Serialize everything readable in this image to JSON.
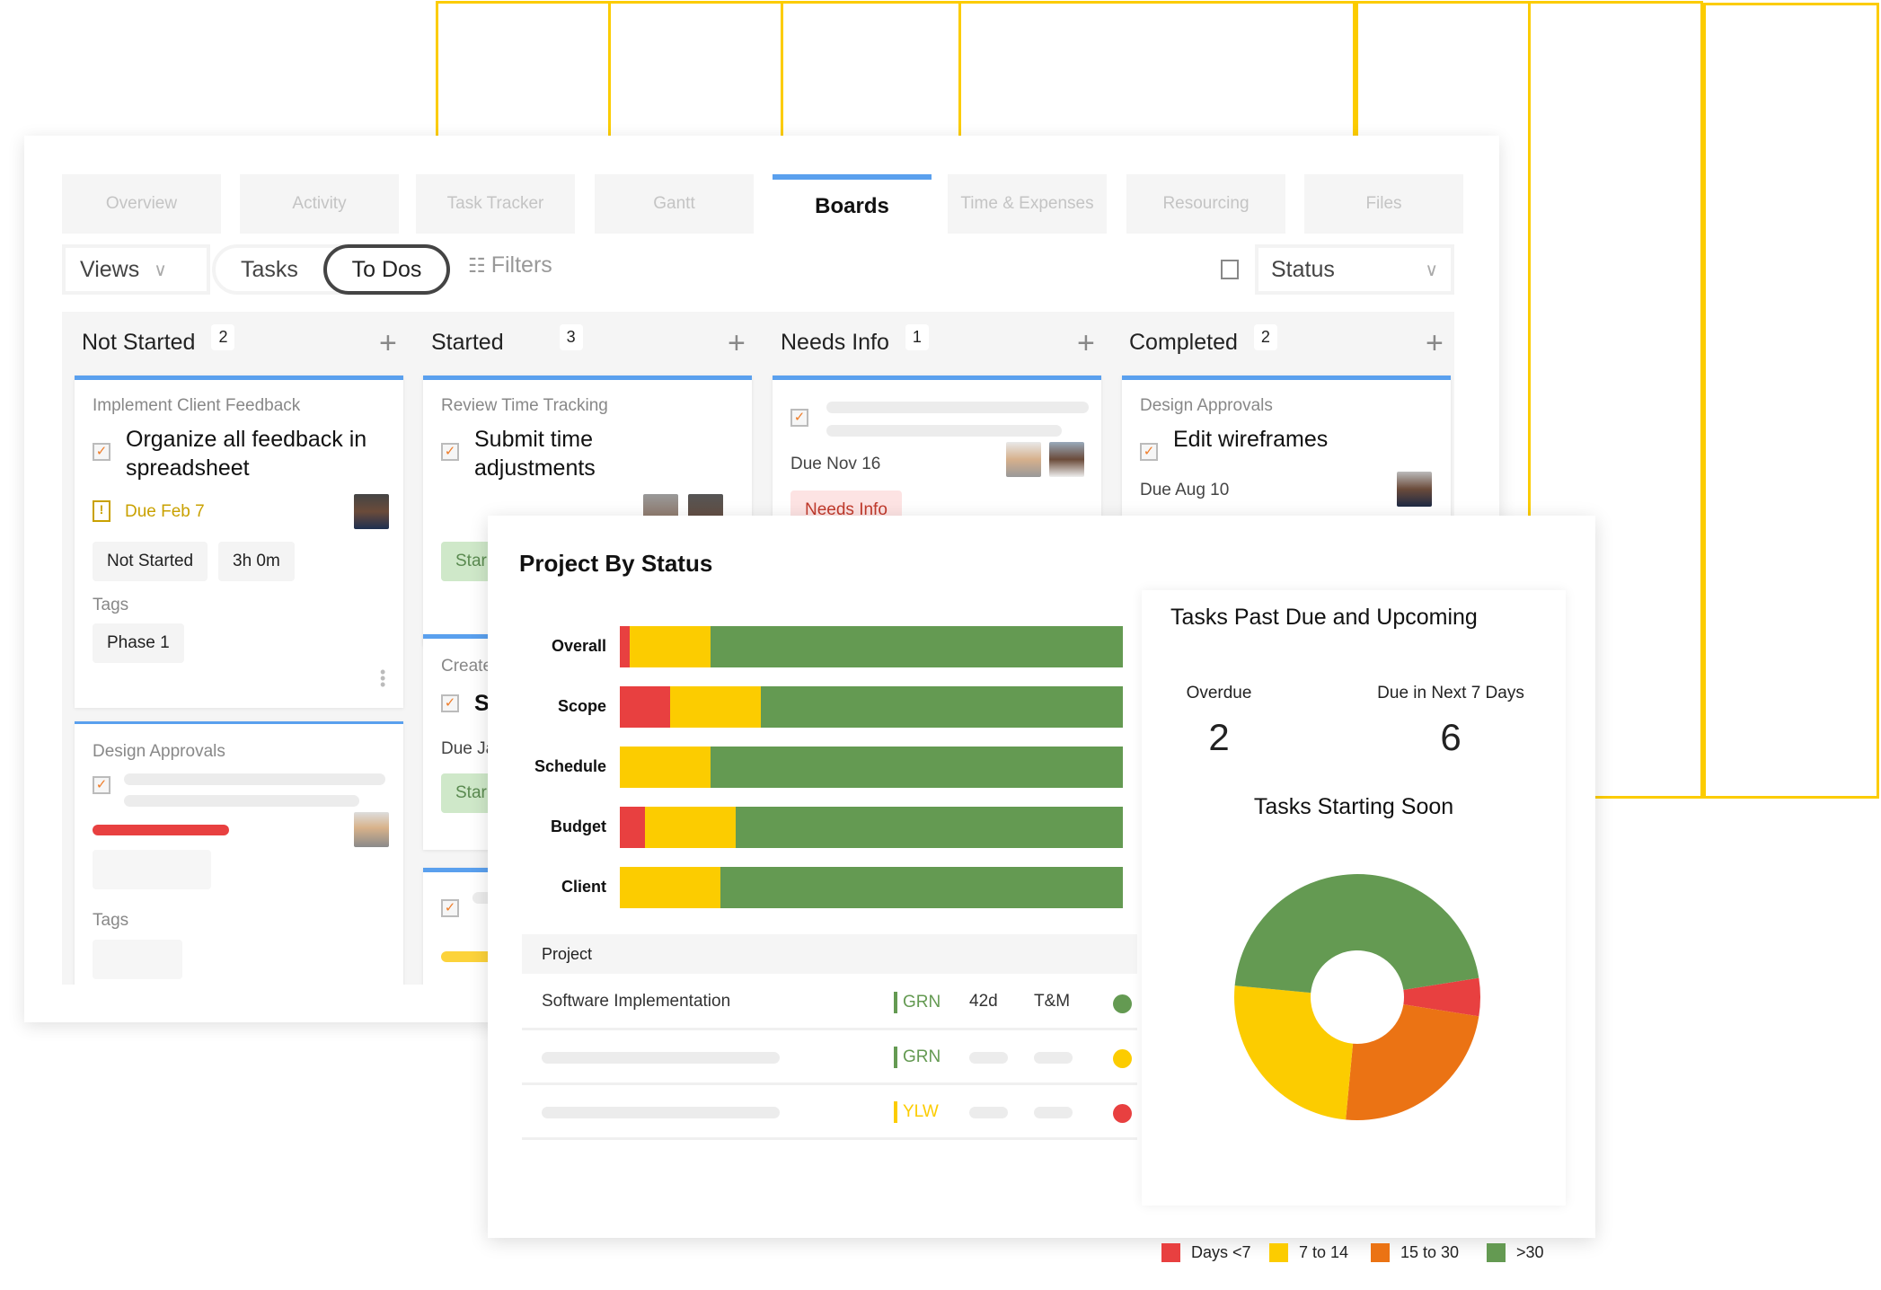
{
  "tabs": [
    "Overview",
    "Activity",
    "Task Tracker",
    "Gantt",
    "Boards",
    "Time & Expenses",
    "Resourcing",
    "Files"
  ],
  "active_tab": "Boards",
  "toolbar": {
    "views": "Views",
    "tasks": "Tasks",
    "todos": "To Dos",
    "filters": "Filters",
    "group_by": "Status"
  },
  "columns": [
    {
      "title": "Not Started",
      "count": "2"
    },
    {
      "title": "Started",
      "count": "3"
    },
    {
      "title": "Needs Info",
      "count": "1"
    },
    {
      "title": "Completed",
      "count": "2"
    }
  ],
  "cards": {
    "ns1": {
      "category": "Implement Client Feedback",
      "title": "Organize all feedback in spreadsheet",
      "due": "Due Feb 7",
      "status": "Not Started",
      "estimate": "3h 0m",
      "tags_label": "Tags",
      "tag": "Phase 1"
    },
    "ns2": {
      "category": "Design Approvals",
      "tags_label": "Tags"
    },
    "st1": {
      "category": "Review Time Tracking",
      "title": "Submit time adjustments",
      "status": "Star"
    },
    "st2": {
      "category": "Create",
      "title": "Se",
      "due": "Due Ja",
      "status": "Star"
    },
    "ni1": {
      "due": "Due Nov 16",
      "status": "Needs Info"
    },
    "cp1": {
      "category": "Design Approvals",
      "title": "Edit wireframes",
      "due": "Due Aug 10"
    }
  },
  "colors": {
    "red": "#e84040",
    "yellow": "#fccc00",
    "orange": "#eb7314",
    "green": "#649a52",
    "accent": "#5aa0ee",
    "due_warning": "#c9a100"
  },
  "dashboard": {
    "title": "Project By Status",
    "table": {
      "header": "Project",
      "rows": [
        {
          "name": "Software Implementation",
          "rag": "GRN",
          "duration": "42d",
          "billing": "T&M",
          "status_color": "green"
        },
        {
          "name": "",
          "rag": "GRN",
          "duration": "",
          "billing": "",
          "status_color": "yellow"
        },
        {
          "name": "",
          "rag": "YLW",
          "duration": "",
          "billing": "",
          "status_color": "red"
        }
      ]
    },
    "panel": {
      "title": "Tasks Past Due and Upcoming",
      "overdue_label": "Overdue",
      "overdue_value": "2",
      "next7_label": "Due in Next 7 Days",
      "next7_value": "6",
      "donut_title": "Tasks Starting Soon"
    }
  },
  "chart_data": [
    {
      "type": "bar",
      "stacked": true,
      "orientation": "horizontal",
      "categories": [
        "Overall",
        "Scope",
        "Schedule",
        "Budget",
        "Client"
      ],
      "series": [
        {
          "color": "#e84040",
          "values": [
            2,
            10,
            0,
            5,
            0
          ]
        },
        {
          "color": "#fccc00",
          "values": [
            16,
            18,
            18,
            18,
            20
          ]
        },
        {
          "color": "#649a52",
          "values": [
            82,
            72,
            82,
            77,
            80
          ]
        }
      ],
      "xlim": [
        0,
        100
      ],
      "grid": false
    },
    {
      "type": "pie",
      "donut": true,
      "title": "Tasks Starting Soon",
      "slices": [
        {
          "label": "Days <7",
          "value": 5,
          "color": "#e84040"
        },
        {
          "label": "15 to 30",
          "value": 24,
          "color": "#eb7314"
        },
        {
          "label": "7 to 14",
          "value": 25,
          "color": "#fccc00"
        },
        {
          "label": ">30",
          "value": 46,
          "color": "#649a52"
        }
      ],
      "legend": [
        "Days <7",
        "7 to 14",
        "15 to 30",
        ">30"
      ],
      "legend_position": "bottom"
    }
  ]
}
